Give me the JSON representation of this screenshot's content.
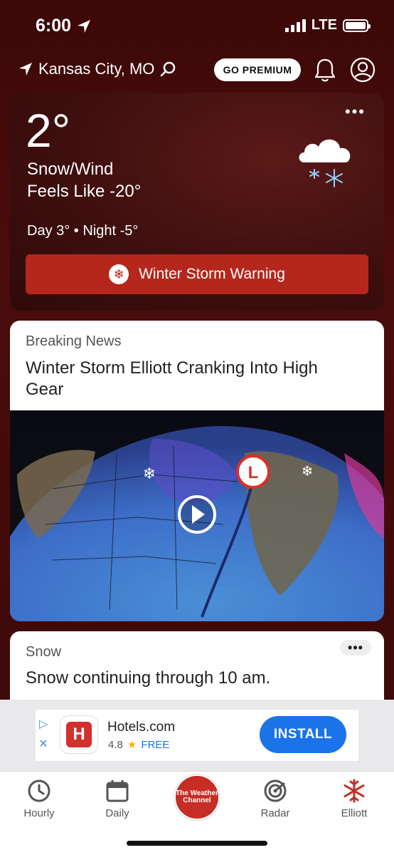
{
  "status": {
    "time": "6:00",
    "network": "LTE"
  },
  "header": {
    "location": "Kansas City, MO",
    "premium_label": "GO PREMIUM"
  },
  "current": {
    "temperature": "2°",
    "condition": "Snow/Wind",
    "feels_like": "Feels Like -20°",
    "day_night": "Day 3° • Night -5°",
    "more_label": "•••",
    "warning": "Winter Storm Warning"
  },
  "news": {
    "kicker": "Breaking News",
    "title": "Winter Storm Elliott Cranking Into High Gear"
  },
  "snow_card": {
    "kicker": "Snow",
    "text": "Snow continuing through 10 am.",
    "more_label": "•••"
  },
  "ad": {
    "brand": "Hotels.com",
    "rating": "4.8",
    "price": "FREE",
    "cta": "INSTALL"
  },
  "tabs": [
    {
      "label": "Hourly",
      "icon": "clock-icon"
    },
    {
      "label": "Daily",
      "icon": "calendar-icon"
    },
    {
      "label": "The Weather Channel",
      "icon": "twc-logo"
    },
    {
      "label": "Radar",
      "icon": "radar-icon"
    },
    {
      "label": "Elliott",
      "icon": "snowflake-icon"
    }
  ],
  "colors": {
    "warning": "#b5271c",
    "accent": "#c62d24",
    "install": "#1a73e8"
  }
}
